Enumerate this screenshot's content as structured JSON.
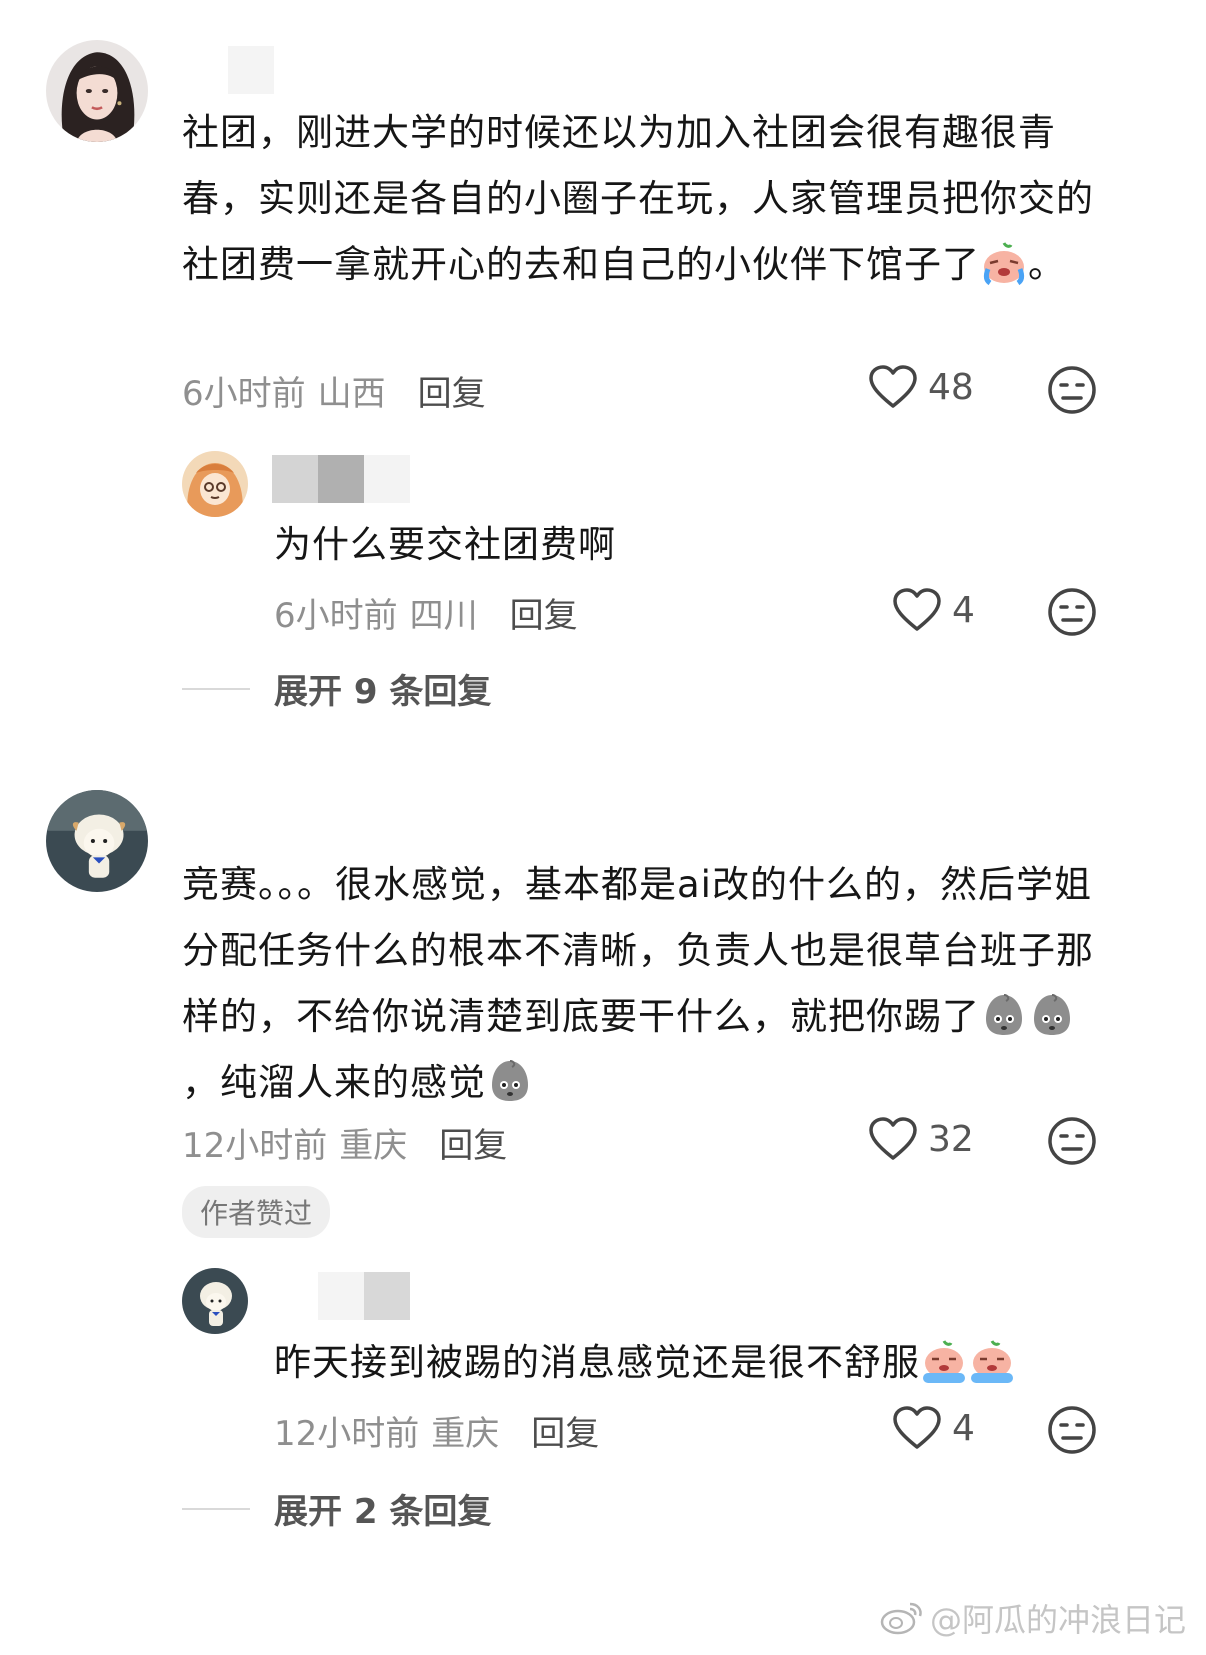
{
  "comments": [
    {
      "text": "社团，刚进大学的时候还以为加入社团会很有趣很青春，实则还是各自的小圈子在玩，人家管理员把你交的社团费一拿就开心的去和自己的小伙伴下馆子了",
      "text_suffix": "。",
      "emoji": "crying-peach-emoji",
      "time": "6小时前",
      "location": "山西",
      "reply_label": "回复",
      "likes": "48",
      "reply": {
        "text": "为什么要交社团费啊",
        "time": "6小时前",
        "location": "四川",
        "reply_label": "回复",
        "likes": "4"
      },
      "expand_label": "展开 9 条回复"
    },
    {
      "text_part1": "竞赛。。。很水感觉，基本都是ai改的什么的，然后学姐分配任务什么的根本不清晰，负责人也是很草台班子那样的，不给你说清楚到底要干什么，就把你踢了",
      "text_part2": "，纯溜人来的感觉",
      "emoji": "grey-sad-blob-emoji",
      "time": "12小时前",
      "location": "重庆",
      "reply_label": "回复",
      "likes": "32",
      "badge": "作者赞过",
      "reply": {
        "text": "昨天接到被踢的消息感觉还是很不舒服",
        "emoji": "crying-peach-emoji",
        "time": "12小时前",
        "location": "重庆",
        "reply_label": "回复",
        "likes": "4"
      },
      "expand_label": "展开 2 条回复"
    }
  ],
  "watermark": "@阿瓜的冲浪日记",
  "icons": {
    "like": "heart-outline-icon",
    "dislike": "meh-face-icon",
    "watermark": "weibo-logo-icon"
  },
  "colors": {
    "text": "#161616",
    "meta": "#8f8f8f",
    "reply": "#4d4d4d",
    "badge_bg": "#efefef"
  }
}
